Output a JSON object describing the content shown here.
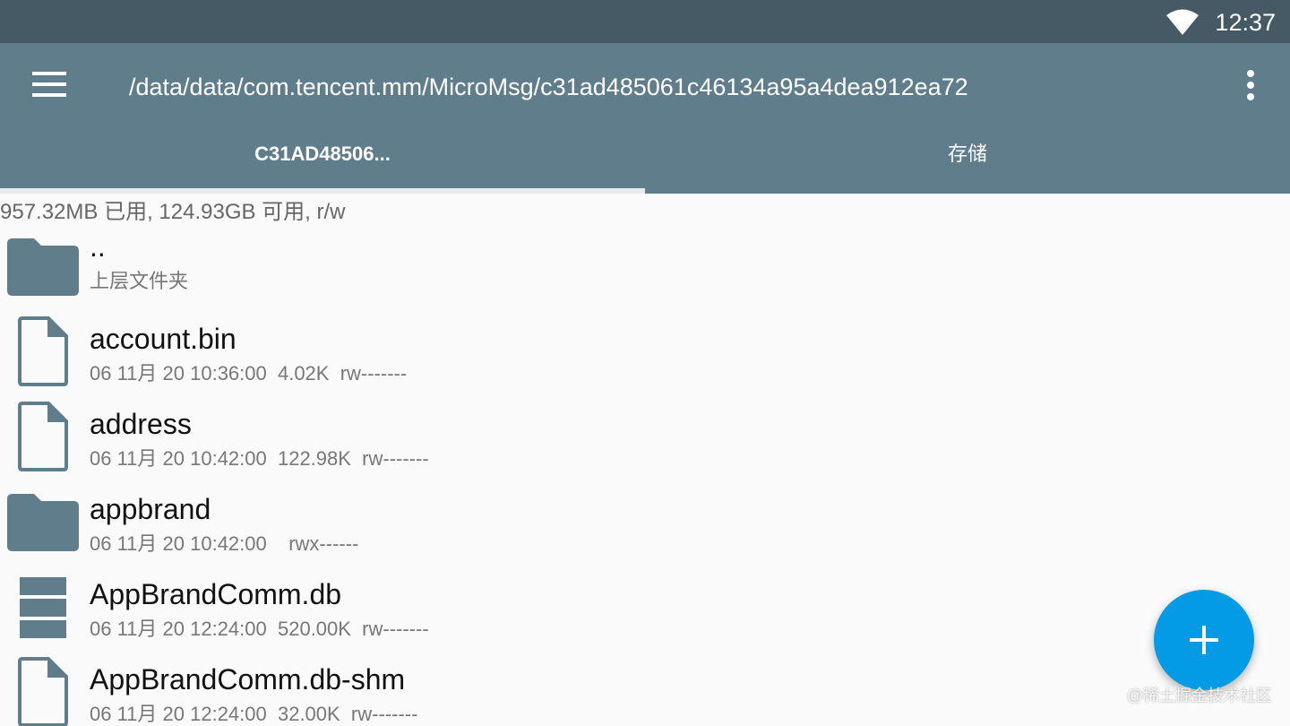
{
  "status_bar": {
    "time": "12:37",
    "wifi_icon": "wifi-icon"
  },
  "toolbar": {
    "menu_icon": "hamburger-icon",
    "path": "/data/data/com.tencent.mm/MicroMsg/c31ad485061c46134a95a4dea912ea72",
    "more_icon": "more-vert-icon"
  },
  "tabs": [
    {
      "label": "C31AD48506...",
      "selected": true
    },
    {
      "label": "存储",
      "selected": false
    }
  ],
  "storage_info": "957.32MB 已用, 124.93GB 可用, r/w",
  "files": [
    {
      "name": "..",
      "meta": "上层文件夹",
      "icon": "folder-icon"
    },
    {
      "name": "account.bin",
      "meta": "06 11月 20 10:36:00  4.02K  rw-------",
      "icon": "file-icon"
    },
    {
      "name": "address",
      "meta": "06 11月 20 10:42:00  122.98K  rw-------",
      "icon": "file-icon"
    },
    {
      "name": "appbrand",
      "meta": "06 11月 20 10:42:00    rwx------",
      "icon": "folder-icon"
    },
    {
      "name": "AppBrandComm.db",
      "meta": "06 11月 20 12:24:00  520.00K  rw-------",
      "icon": "database-icon"
    },
    {
      "name": "AppBrandComm.db-shm",
      "meta": "06 11月 20 12:24:00  32.00K  rw-------",
      "icon": "file-icon"
    }
  ],
  "fab_icon": "plus-icon",
  "watermark": "@稀土掘金技术社区",
  "colors": {
    "status_bar": "#455a64",
    "toolbar": "#607d8b",
    "icon": "#607d8b",
    "fab": "#039be5"
  }
}
